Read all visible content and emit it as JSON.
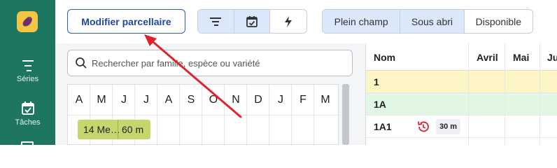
{
  "sidebar": {
    "items": [
      {
        "label": "Séries",
        "icon": "series-icon"
      },
      {
        "label": "Tâches",
        "icon": "calendar-check-icon"
      }
    ]
  },
  "toolbar": {
    "modify_label": "Modifier parcellaire",
    "view_buttons": [
      {
        "icon": "filter-lines-icon",
        "active": true
      },
      {
        "icon": "calendar-check-icon",
        "active": true
      },
      {
        "icon": "lightning-icon",
        "active": false
      }
    ],
    "filters": [
      {
        "label": "Plein champ",
        "active": true
      },
      {
        "label": "Sous abri",
        "active": true
      },
      {
        "label": "Disponible",
        "active": false
      }
    ]
  },
  "search": {
    "placeholder": "Rechercher par famille, espèce ou variété"
  },
  "calendar": {
    "months": [
      "A",
      "M",
      "J",
      "J",
      "A",
      "S",
      "O",
      "N",
      "D",
      "J",
      "F",
      "M"
    ],
    "culture": {
      "name": "14 Me…",
      "length": "60 m",
      "color": "#c5d66d"
    }
  },
  "grid": {
    "headers": [
      "Nom",
      "Avril",
      "Mai",
      "Ju"
    ],
    "rows": [
      {
        "name": "1",
        "bg": "#fdf6c4"
      },
      {
        "name": "1A",
        "bg": "#e1f7e4"
      },
      {
        "name": "1A1",
        "bg": "#ffffff",
        "badge": "30 m",
        "history_icon": "history-icon"
      }
    ]
  },
  "colors": {
    "sidebar": "#1e7562",
    "accent": "#2f5db7",
    "annotation": "#e0232f"
  }
}
